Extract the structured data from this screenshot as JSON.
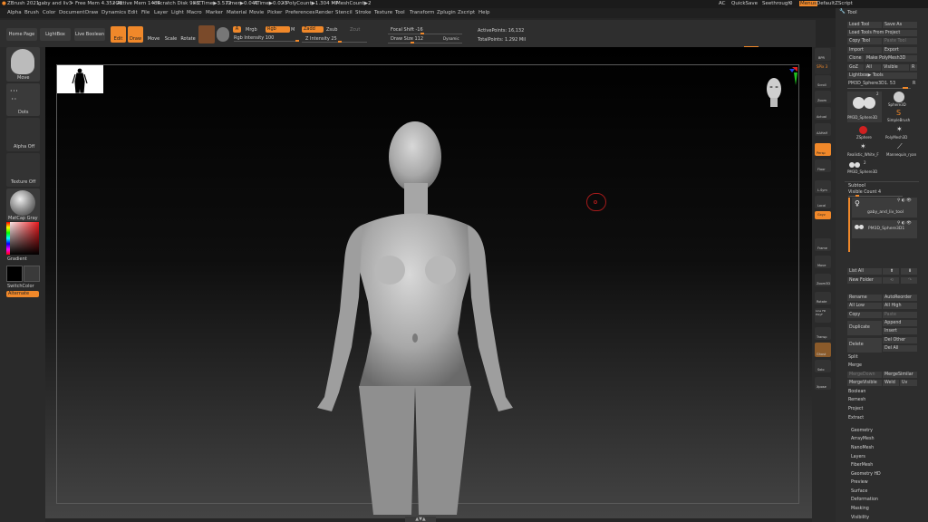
{
  "titlebar": {
    "app": "ZBrush 2021",
    "file": "gaby and liv3",
    "free_mem": "• Free Mem 4.352GB",
    "active_mem": "• Active Mem 1484",
    "scratch": "• Scratch Disk 988",
    "ztime": "• ZTime▶3.572",
    "timer": "Timer▶0.041",
    "atime": "ATime▶0.023",
    "polycount": "• PolyCount▶1.304 MP",
    "meshcount": "• MeshCount▶2",
    "ac": "AC",
    "quicksave": "QuickSave",
    "seethrough": "Seethrough",
    "seethrough_val": "0",
    "menus": "Menus",
    "defaultzscript": "DefaultZScript"
  },
  "menus": [
    "Alpha",
    "Brush",
    "Color",
    "Document",
    "Draw",
    "Dynamics",
    "Edit",
    "File",
    "Layer",
    "Light",
    "Macro",
    "Marker",
    "Material",
    "Movie",
    "Picker",
    "Preferences",
    "Render",
    "Stencil",
    "Stroke",
    "Texture",
    "Tool",
    "Transform",
    "Zplugin",
    "Zscript",
    "Help"
  ],
  "toolbar": {
    "home": "Home Page",
    "lightbox": "LightBox",
    "live_boolean": "Live Boolean",
    "edit": "Edit",
    "draw": "Draw",
    "move": "Move",
    "scale": "Scale",
    "rotate": "Rotate",
    "a": "A",
    "mrgb": "Mrgb",
    "rgb": "Rgb",
    "m": "M",
    "zadd": "Zadd",
    "zsub": "Zsub",
    "zcut": "Zcut",
    "rgb_intensity": "Rgb Intensity 100",
    "z_intensity": "Z Intensity 25",
    "focal_shift": "Focal Shift -16",
    "draw_size": "Draw Size 112",
    "dynamic": "Dynamic",
    "active_points": "ActivePoints: 16,132",
    "total_points": "TotalPoints: 1.292 Mil"
  },
  "left": {
    "move": "Move",
    "dots": "Dots",
    "alpha_off": "Alpha Off",
    "texture_off": "Texture Off",
    "matcap": "MatCap Gray",
    "gradient": "Gradient",
    "switch_color": "SwitchColor",
    "alternate": "Alternate"
  },
  "right_icons": [
    "BPR",
    "SPix 3",
    "Scroll",
    "Zoom",
    "Actual",
    "AAHalf",
    "Persp",
    "Floor",
    "L.Sym",
    "Local",
    "Gxyz",
    "Frame",
    "Move",
    "Zoom3D",
    "Rotate",
    "Line Fill PolyF",
    "Transp",
    "Ghost",
    "Solo",
    "Xpose"
  ],
  "tool": {
    "title": "Tool",
    "load": "Load Tool",
    "save_as": "Save As",
    "load_proj": "Load Tools From Project",
    "copy": "Copy Tool",
    "paste": "Paste Tool",
    "import": "Import",
    "export": "Export",
    "clone": "Clone",
    "make_poly": "Make PolyMesh3D",
    "goz": "GoZ",
    "all": "All",
    "visible": "Visible",
    "r": "R",
    "lightbox_tools": "Lightbox▶ Tools",
    "current": "PM3D_Sphere3D1. 53",
    "r2": "R",
    "thumbs": [
      "PM3D_Sphere3D",
      "Sphere3D",
      "SimpleBrush",
      "ZSphere",
      "PolyMesh3D",
      "Realistic_White_F",
      "Mannequin_ryan",
      "PM3D_Sphere3D"
    ],
    "thumb_count1": "2",
    "thumb_count2": "2",
    "subtool": "Subtool",
    "visible_count": "Visible Count 4",
    "subtool1": "gaby_and_liv_tool",
    "subtool2": "PM3D_Sphere3D1",
    "list_all": "List All",
    "new_folder": "New Folder",
    "rename": "Rename",
    "autoreorder": "AutoReorder",
    "all_low": "All Low",
    "all_high": "All High",
    "copy2": "Copy",
    "paste2": "Paste",
    "append": "Append",
    "duplicate": "Duplicate",
    "insert": "Insert",
    "delete": "Delete",
    "del_other": "Del Other",
    "del_all": "Del All",
    "split": "Split",
    "merge": "Merge",
    "merge_down": "MergeDown",
    "merge_similar": "MergeSimilar",
    "merge_visible": "MergeVisible",
    "weld": "Weld",
    "uv": "Uv",
    "boolean": "Boolean",
    "remesh": "Remesh",
    "project": "Project",
    "extract": "Extract"
  },
  "sections": [
    "Geometry",
    "ArrayMesh",
    "NanoMesh",
    "Layers",
    "FiberMesh",
    "Geometry HD",
    "Preview",
    "Surface",
    "Deformation",
    "Masking",
    "Visibility"
  ],
  "colors": {
    "accent": "#f0882a"
  }
}
